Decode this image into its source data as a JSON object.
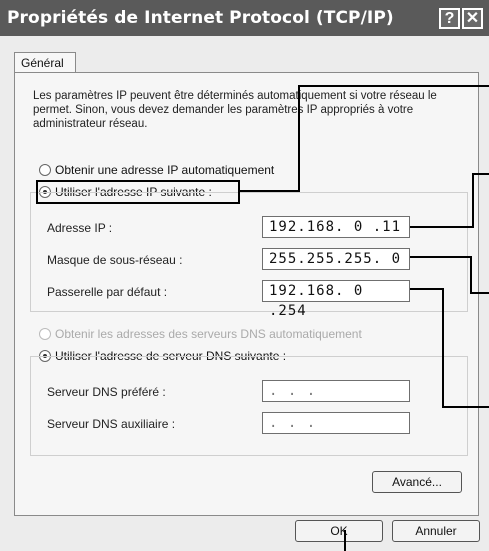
{
  "window": {
    "title": "Propriétés de Internet Protocol (TCP/IP)",
    "help_glyph": "?",
    "close_glyph": "✕"
  },
  "tab": {
    "label": "Général"
  },
  "description": "Les paramètres IP peuvent être déterminés automatiquement si votre réseau le permet. Sinon, vous devez demander les paramètres IP appropriés à votre administrateur réseau.",
  "ip_mode": {
    "auto_label": "Obtenir une adresse IP automatiquement",
    "manual_label": "Utiliser l'adresse IP suivante :",
    "selected": "manual"
  },
  "ip_fields": {
    "address_label": "Adresse IP :",
    "address_value": "192.168.  0 .11",
    "mask_label": "Masque de sous-réseau :",
    "mask_value": "255.255.255.  0",
    "gateway_label": "Passerelle par défaut :",
    "gateway_value": "192.168.  0 .254"
  },
  "dns_mode": {
    "auto_label": "Obtenir les adresses des serveurs DNS automatiquement",
    "manual_label": "Utiliser l'adresse de serveur DNS suivante :",
    "selected": "manual"
  },
  "dns_fields": {
    "preferred_label": "Serveur DNS préféré :",
    "preferred_value": " .    .    .",
    "alternate_label": "Serveur DNS auxiliaire :",
    "alternate_value": " .    .    ."
  },
  "buttons": {
    "advanced": "Avancé...",
    "ok": "OK",
    "cancel": "Annuler"
  }
}
